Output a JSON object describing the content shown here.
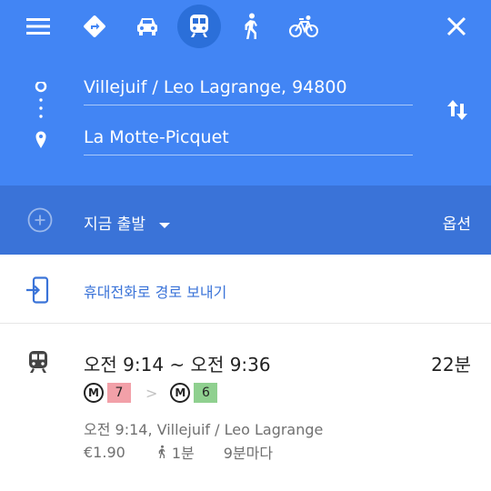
{
  "header": {
    "menu_icon": "menu-icon",
    "modes": [
      {
        "name": "directions",
        "icon": "directions-icon",
        "active": false
      },
      {
        "name": "car",
        "icon": "car-icon",
        "active": false
      },
      {
        "name": "transit",
        "icon": "train-icon",
        "active": true
      },
      {
        "name": "walk",
        "icon": "walk-icon",
        "active": false
      },
      {
        "name": "bike",
        "icon": "bike-icon",
        "active": false
      }
    ],
    "close_icon": "close-icon"
  },
  "route": {
    "origin": "Villejuif / Leo Lagrange, 94800",
    "destination": "La Motte-Picquet",
    "swap_icon": "swap-icon"
  },
  "time_bar": {
    "depart_label": "지금 출발",
    "options_label": "옵션"
  },
  "send": {
    "label": "휴대전화로 경로 보내기"
  },
  "result": {
    "times": "오전 9:14 ~ 오전 9:36",
    "duration": "22분",
    "metro_symbol": "M",
    "lines": [
      {
        "number": "7",
        "color": "#f2a0a8"
      },
      {
        "number": "6",
        "color": "#8fd08f"
      }
    ],
    "departure": "오전 9:14, Villejuif / Leo Lagrange",
    "fare": "€1.90",
    "walk_time": "1분",
    "frequency": "9분마다"
  },
  "colors": {
    "header_blue": "#4285f4",
    "time_bar_blue": "#3a73d8",
    "link_blue": "#3a73d8"
  }
}
